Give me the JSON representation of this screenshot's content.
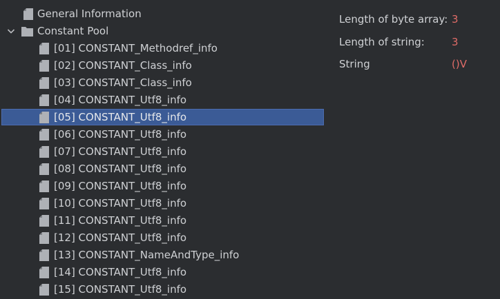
{
  "tree": {
    "general": {
      "label": "General Information"
    },
    "pool": {
      "label": "Constant Pool",
      "items": [
        {
          "label": "[01] CONSTANT_Methodref_info"
        },
        {
          "label": "[02] CONSTANT_Class_info"
        },
        {
          "label": "[03] CONSTANT_Class_info"
        },
        {
          "label": "[04] CONSTANT_Utf8_info"
        },
        {
          "label": "[05] CONSTANT_Utf8_info"
        },
        {
          "label": "[06] CONSTANT_Utf8_info"
        },
        {
          "label": "[07] CONSTANT_Utf8_info"
        },
        {
          "label": "[08] CONSTANT_Utf8_info"
        },
        {
          "label": "[09] CONSTANT_Utf8_info"
        },
        {
          "label": "[10] CONSTANT_Utf8_info"
        },
        {
          "label": "[11] CONSTANT_Utf8_info"
        },
        {
          "label": "[12] CONSTANT_Utf8_info"
        },
        {
          "label": "[13] CONSTANT_NameAndType_info"
        },
        {
          "label": "[14] CONSTANT_Utf8_info"
        },
        {
          "label": "[15] CONSTANT_Utf8_info"
        }
      ]
    }
  },
  "details": [
    {
      "label": "Length of byte array:",
      "value": "3"
    },
    {
      "label": "Length of string:",
      "value": "3"
    },
    {
      "label": "String",
      "value": "()V"
    }
  ],
  "colors": {
    "background": "#2b2d30",
    "selection": "#3b5b96",
    "value": "#e06c68",
    "icon": "#aeb1b6"
  },
  "icons": {
    "chevron": "chevron-down-icon",
    "folder": "folder-icon",
    "file": "file-icon"
  }
}
